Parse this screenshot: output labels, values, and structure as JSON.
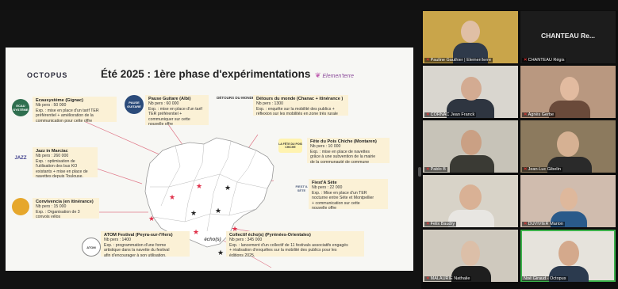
{
  "slide": {
    "logo": "OCTOPUS",
    "title": "Été 2025 : 1ère phase d'expérimentations",
    "partner": "Elemen'terre",
    "cards": [
      {
        "id": "ecausysteme",
        "title": "Ecausystème (Gignac)",
        "lines": [
          "Nb pers : 50 000",
          "Exp. : mise en place d'un tarif TER",
          "préférentiel + amélioration de la",
          "communication pour cette offre"
        ]
      },
      {
        "id": "jazz",
        "title": "Jazz in Marciac",
        "lines": [
          "Nb pers : 260 000",
          "Exp. : optimisation de",
          "l'utilisation des bus KO",
          "existants + mise en place de",
          "navettes depuis Toulouse."
        ]
      },
      {
        "id": "convivencia",
        "title": "Convivencia (en itinérance)",
        "lines": [
          "Nb pers : 15 000",
          "Exp. : Organisation de 3",
          "convois vélos"
        ]
      },
      {
        "id": "atom",
        "title": "ATOM Festival (Peyra-sur-l'Hers)",
        "lines": [
          "Nb pers : 1400",
          "Exp. : programmation d'une forme",
          "artistique dans la navette du festival",
          "afin d'encourager à son utilisation."
        ]
      },
      {
        "id": "pause",
        "title": "Pause Guitare (Albi)",
        "lines": [
          "Nb pers : 60 000",
          "Exp. : mise en place d'un tarif",
          "TER préférentiel +",
          "communiquer sur cette",
          "nouvelle offre"
        ]
      },
      {
        "id": "detours",
        "title": "Détours du monde (Chanac + itinérance )",
        "lines": [
          "Nb pers : 1300",
          "Exp. : enquête sur la mobilité des publics +",
          "réflexion sur les mobilités en zone très rurale"
        ]
      },
      {
        "id": "poischiche",
        "title": "Fête du Pois Chiche (Montaren)",
        "lines": [
          "Nb pers : 10 000",
          "Exp. : mise en place de navettes",
          "grâce à une subvention de la mairie",
          "de la communauté de commune"
        ]
      },
      {
        "id": "fiestasete",
        "title": "Fiest'A Sète",
        "lines": [
          "Nb pers : 22 000",
          "Exp. : Mise en place d'un TER",
          "nocturne entre Sète et Montpellier",
          "+ communication sur cette",
          "nouvelle offre"
        ]
      },
      {
        "id": "collectif",
        "title": "Collectif écho(s) (Pyrénées-Orientales)",
        "lines": [
          "Nb pers : 345 000",
          "Exp. : lancement d'un collectif de 11 festivals associatifs engagés",
          "+ réalisation d'enquêtes sur la mobilité des publics pour les",
          "éditions 2025."
        ]
      }
    ],
    "logos": {
      "detours": "DÉTOURS DU MONDE",
      "poischiche": "LA FÊTE DU POIS CHICHE",
      "fiestasete": "FIEST'A SÈTE",
      "echos": "écho(s)",
      "atom": "ATOM",
      "jazz": "JAZZ",
      "pause": "PAUSE GUITARE",
      "eco": "ECAU SYSTÈME"
    },
    "colors": {
      "card_bg": "#fbf1d6",
      "star_red": "#e0304a",
      "star_black": "#222222",
      "connector": "#e07a8a"
    }
  },
  "gallery": [
    {
      "name": "Pauline Gauthier | Elemen'terre",
      "muted": true,
      "bg": "#c9a54a"
    },
    {
      "name": "CHANTEAU Régis",
      "muted": true,
      "big": "CHANTEAU Re...",
      "bg": "#1c1c1c"
    },
    {
      "name": "CORNAC Jean Franck",
      "muted": true,
      "bg": "#d9d6cf"
    },
    {
      "name": "Agnès Gerbe",
      "muted": true,
      "bg": "#b99880"
    },
    {
      "name": "Pablo B",
      "muted": true,
      "bg": "#c7c3b8"
    },
    {
      "name": "Jean-Luc Gibelin",
      "muted": true,
      "bg": "#8c7a5e"
    },
    {
      "name": "Felix Baudry",
      "muted": true,
      "bg": "#d8d3c8"
    },
    {
      "name": "DUVIVIER Marion",
      "muted": true,
      "bg": "#d0bcae"
    },
    {
      "name": "MALAURIE Nathalie",
      "muted": true,
      "bg": "#cfc9be"
    },
    {
      "name": "Noé Giraud - Octopus",
      "muted": false,
      "bg": "#e6e3dc"
    }
  ]
}
